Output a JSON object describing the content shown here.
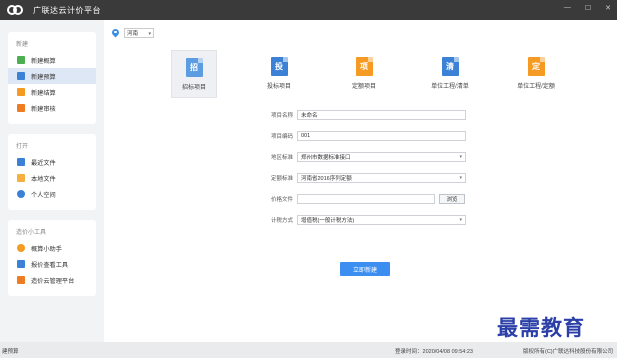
{
  "app": {
    "title": "广联达云计价平台"
  },
  "sidebar": {
    "groups": [
      {
        "title": "新建",
        "items": [
          {
            "label": "新建概算",
            "icon": "budget-estimate-icon",
            "color": "#4caf50",
            "active": false
          },
          {
            "label": "新建预算",
            "icon": "budget-icon",
            "color": "#3b82d6",
            "active": true
          },
          {
            "label": "新建结算",
            "icon": "settlement-icon",
            "color": "#f59a23",
            "active": false
          },
          {
            "label": "新建审核",
            "icon": "audit-icon",
            "color": "#f07c22",
            "active": false
          }
        ]
      },
      {
        "title": "打开",
        "items": [
          {
            "label": "最近文件",
            "icon": "recent-files-icon",
            "color": "#3b82d6"
          },
          {
            "label": "本地文件",
            "icon": "local-files-icon",
            "color": "#f5b041"
          },
          {
            "label": "个人空间",
            "icon": "personal-space-icon",
            "color": "#3b82d6"
          }
        ]
      },
      {
        "title": "造价小工具",
        "items": [
          {
            "label": "概算小助手",
            "icon": "estimate-assistant-icon",
            "color": "#f59a23"
          },
          {
            "label": "报价查看工具",
            "icon": "quote-viewer-icon",
            "color": "#3b82d6"
          },
          {
            "label": "造价云管理平台",
            "icon": "cloud-platform-icon",
            "color": "#f07c22"
          }
        ]
      }
    ]
  },
  "region": {
    "value": "河南"
  },
  "tiles": [
    {
      "label": "招标项目",
      "glyph": "招",
      "color": "#5b9de0",
      "selected": true
    },
    {
      "label": "投标项目",
      "glyph": "投",
      "color": "#3b82d6",
      "selected": false
    },
    {
      "label": "定额项目",
      "glyph": "项",
      "color": "#f59a23",
      "selected": false
    },
    {
      "label": "单位工程/清单",
      "glyph": "清",
      "color": "#3b82d6",
      "selected": false
    },
    {
      "label": "单位工程/定额",
      "glyph": "定",
      "color": "#f59a23",
      "selected": false
    }
  ],
  "form": {
    "project_name": {
      "label": "项目名称",
      "value": "未命名"
    },
    "project_code": {
      "label": "项目编码",
      "value": "001"
    },
    "region_standard": {
      "label": "地区标准",
      "value": "郑州市数据标准接口"
    },
    "quota_standard": {
      "label": "定额标准",
      "value": "河南省2016序列定额"
    },
    "price_file": {
      "label": "价格文件",
      "value": "",
      "browse_label": "浏览"
    },
    "tax_method": {
      "label": "计税方式",
      "value": "增值税(一般计税方法)"
    }
  },
  "submit_label": "立即新建",
  "status": {
    "left_text": "建预算",
    "login_time_label": "登录时间：",
    "login_time": "2020/04/08 09:54:23",
    "copyright": "版权所有(C)广联达科技股份有限公司"
  },
  "watermark": "最需教育"
}
